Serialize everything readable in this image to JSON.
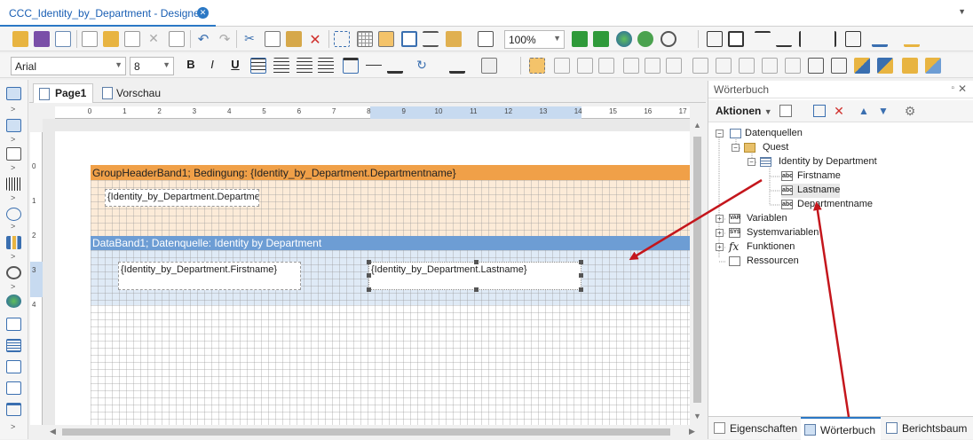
{
  "window": {
    "doc_tab_title": "CCC_Identity_by_Department - Designer",
    "close_glyph": "✕",
    "menu_glyph": "▼"
  },
  "toolbar1": {
    "zoom_value": "100%"
  },
  "toolbar2": {
    "font_family": "Arial",
    "font_size": "8",
    "bold": "B",
    "italic": "I",
    "underline": "U"
  },
  "page_tabs": {
    "page1": "Page1",
    "preview": "Vorschau"
  },
  "ruler": {
    "h_labels": [
      "0",
      "1",
      "2",
      "3",
      "4",
      "5",
      "6",
      "7",
      "8",
      "9",
      "10",
      "11",
      "12",
      "13",
      "14",
      "15",
      "16",
      "17"
    ],
    "v_labels": [
      "0",
      "1",
      "2",
      "3",
      "4"
    ]
  },
  "bands": {
    "group_header_title": "GroupHeaderBand1; Bedingung: {Identity_by_Department.Departmentname}",
    "group_header_field": "{Identity_by_Department.Departmentname}",
    "data_band_title": "DataBand1; Datenquelle: Identity by Department",
    "field_firstname": "{Identity_by_Department.Firstname}",
    "field_lastname": "{Identity_by_Department.Lastname}"
  },
  "panel": {
    "title": "Wörterbuch",
    "pin_glyph": "▫",
    "close_glyph": "✕",
    "actions": "Aktionen",
    "tree": {
      "datasources": "Datenquellen",
      "quest": "Quest",
      "identity": "Identity by Department",
      "firstname": "Firstname",
      "lastname": "Lastname",
      "departmentname": "Departmentname",
      "variables": "Variablen",
      "systemvariables": "Systemvariablen",
      "functions": "Funktionen",
      "resources": "Ressourcen"
    },
    "tabs": {
      "properties": "Eigenschaften",
      "dictionary": "Wörterbuch",
      "reporttree": "Berichtsbaum"
    }
  },
  "colors": {
    "group_header_band": "#f0a048",
    "data_band": "#6d9dd4",
    "annotation_arrow": "#c4161c",
    "accent": "#2b78c5"
  }
}
